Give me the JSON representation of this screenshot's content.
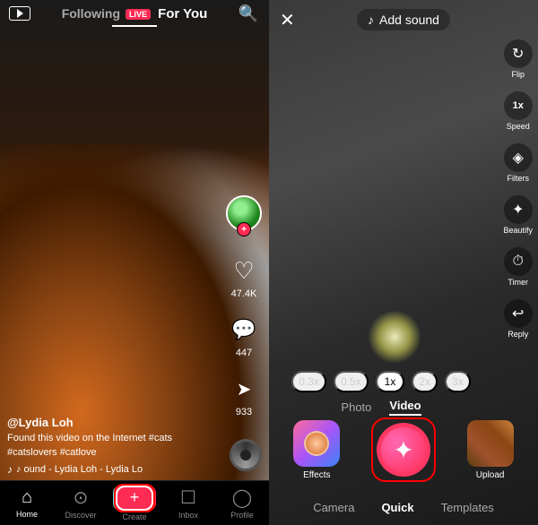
{
  "left": {
    "nav": {
      "live_label": "LIVE",
      "following_label": "Following",
      "foryou_label": "For You",
      "search_icon": "search"
    },
    "video": {
      "username": "@Lydia Loh",
      "description": "Found this video on the Internet #cats #catslovers #catlove",
      "music": "♪ ound - Lydia Loh - Lydia Lo",
      "likes": "47.4K",
      "comments": "447",
      "shares": "933"
    },
    "tabs": [
      {
        "id": "home",
        "label": "Home",
        "icon": "⌂",
        "active": true
      },
      {
        "id": "discover",
        "label": "Discover",
        "icon": "○"
      },
      {
        "id": "create",
        "label": "Create",
        "icon": "+"
      },
      {
        "id": "inbox",
        "label": "Inbox",
        "icon": "☐"
      },
      {
        "id": "profile",
        "label": "Profile",
        "icon": "👤"
      }
    ]
  },
  "right": {
    "top": {
      "close_icon": "✕",
      "add_sound_label": "Add sound",
      "music_icon": "♪"
    },
    "sidebar": [
      {
        "id": "flip",
        "label": "Flip",
        "icon": "↻"
      },
      {
        "id": "speed",
        "label": "1x\nSpeed",
        "icon": "1x"
      },
      {
        "id": "filters",
        "label": "Filters",
        "icon": "◈"
      },
      {
        "id": "beautify",
        "label": "Beautify",
        "icon": "✦"
      },
      {
        "id": "timer",
        "label": "Timer",
        "icon": "⏱"
      },
      {
        "id": "reply",
        "label": "Reply",
        "icon": "↩"
      }
    ],
    "speed_options": [
      "0.3x",
      "0.5x",
      "1x",
      "2x",
      "3x"
    ],
    "active_speed": "1x",
    "mode_tabs": [
      "Photo",
      "Video"
    ],
    "active_mode": "Video",
    "bottom_actions": [
      {
        "id": "effects",
        "label": "Effects"
      },
      {
        "id": "capture",
        "label": ""
      },
      {
        "id": "upload",
        "label": "Upload"
      }
    ],
    "camera_tabs": [
      "Camera",
      "Quick",
      "Templates"
    ],
    "active_camera_tab": "Quick"
  }
}
